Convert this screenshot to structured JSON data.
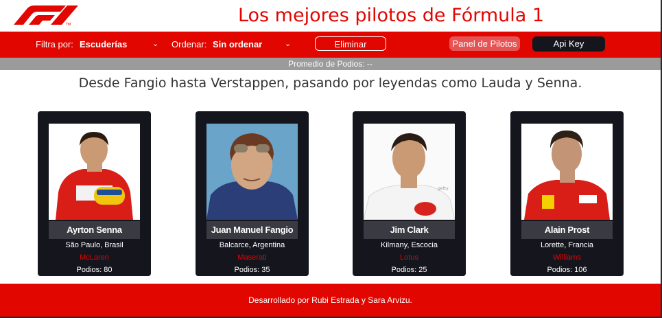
{
  "header": {
    "title": "Los mejores pilotos de Fórmula 1"
  },
  "nav": {
    "filter_label": "Filtra por:",
    "filter_value": "Escuderías",
    "sort_label": "Ordenar:",
    "sort_value": "Sin ordenar",
    "delete_button": "Eliminar",
    "panel_button": "Panel de Pilotos",
    "api_button": "Api Key"
  },
  "stats": {
    "podium_average": "Promedio de Podios: --"
  },
  "subtitle": "Desde Fangio hasta Verstappen, pasando por leyendas como Lauda y Senna.",
  "drivers": [
    {
      "name": "Ayrton Senna",
      "place": "São Paulo, Brasil",
      "team": "McLaren",
      "podiums": "Podios: 80"
    },
    {
      "name": "Juan Manuel Fangio",
      "place": "Balcarce, Argentina",
      "team": "Maserati",
      "podiums": "Podios: 35"
    },
    {
      "name": "Jim Clark",
      "place": "Kilmany, Escocia",
      "team": "Lotus",
      "podiums": "Podios: 25"
    },
    {
      "name": "Alain Prost",
      "place": "Lorette, Francia",
      "team": "Williams",
      "podiums": "Podios: 106"
    }
  ],
  "footer": {
    "credit": "Desarrollado por Rubi Estrada y Sara Arvizu."
  },
  "colors": {
    "accent": "#e10600",
    "dark": "#15151e",
    "gray_bar": "#9b9b9b",
    "panel_button": "#e55454"
  }
}
